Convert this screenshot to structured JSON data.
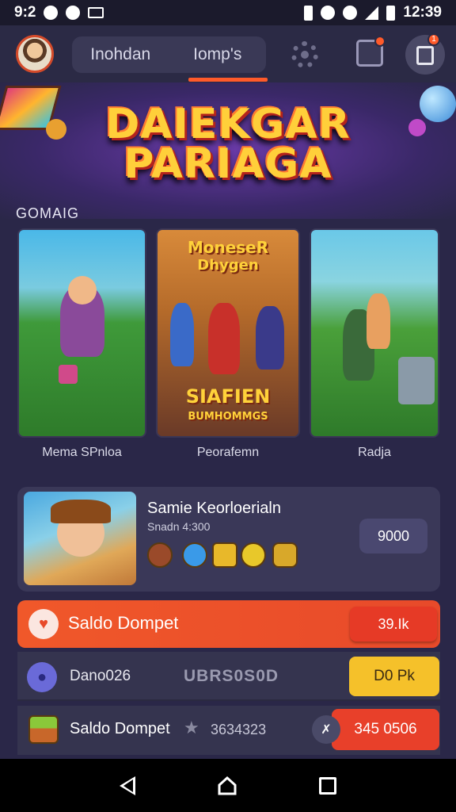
{
  "status_bar": {
    "left_text": "9:2",
    "time": "12:39"
  },
  "header": {
    "tabs": [
      {
        "label": "Inohdan"
      },
      {
        "label": "Iomp's"
      }
    ],
    "notification_badge": "1"
  },
  "banner": {
    "title_line1": "DAIEKGAR",
    "title_line2": "PARIAGA"
  },
  "games": {
    "section_label": "GOMAIG",
    "cards": [
      {
        "caption": "Mema SPnloa"
      },
      {
        "caption": "Peorafemn",
        "art_top": "MoneseR",
        "art_top2": "Dhygen",
        "art_bottom": "SIAFIEN",
        "art_bottom2": "BUMHOMMGS"
      },
      {
        "caption": "Radja"
      }
    ]
  },
  "featured": {
    "title": "Samie Keorloerialn",
    "subtitle": "Snadn 4:300",
    "price": "9000"
  },
  "wallet": {
    "row1": {
      "label": "Saldo Dompet",
      "value": "39.Ik"
    },
    "row2": {
      "label": "Dano026",
      "code": "UBRS0S0D",
      "value": "D0 Pk"
    },
    "row3": {
      "label": "Saldo Dompet",
      "code": "3634323",
      "value": "345 0506"
    }
  },
  "colors": {
    "accent": "#ff5a2a",
    "background": "#2a2748",
    "gold": "#f5c12a"
  }
}
